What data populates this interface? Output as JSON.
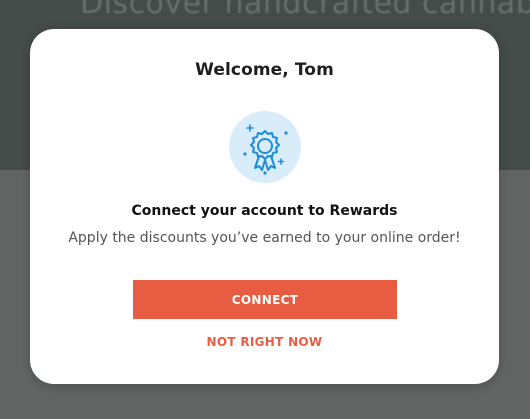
{
  "background": {
    "hero_text": "Discover handcrafted cannabis from our premium brand partners"
  },
  "modal": {
    "title": "Welcome, Tom",
    "badge_icon": "award-ribbon-icon",
    "heading": "Connect your account to Rewards",
    "subtext": "Apply the discounts you’ve earned to your online order!",
    "connect_label": "CONNECT",
    "skip_label": "NOT RIGHT NOW"
  },
  "colors": {
    "accent": "#e85d42",
    "badge_bg": "#d8ecfa",
    "badge_icon": "#1c8ddb"
  }
}
